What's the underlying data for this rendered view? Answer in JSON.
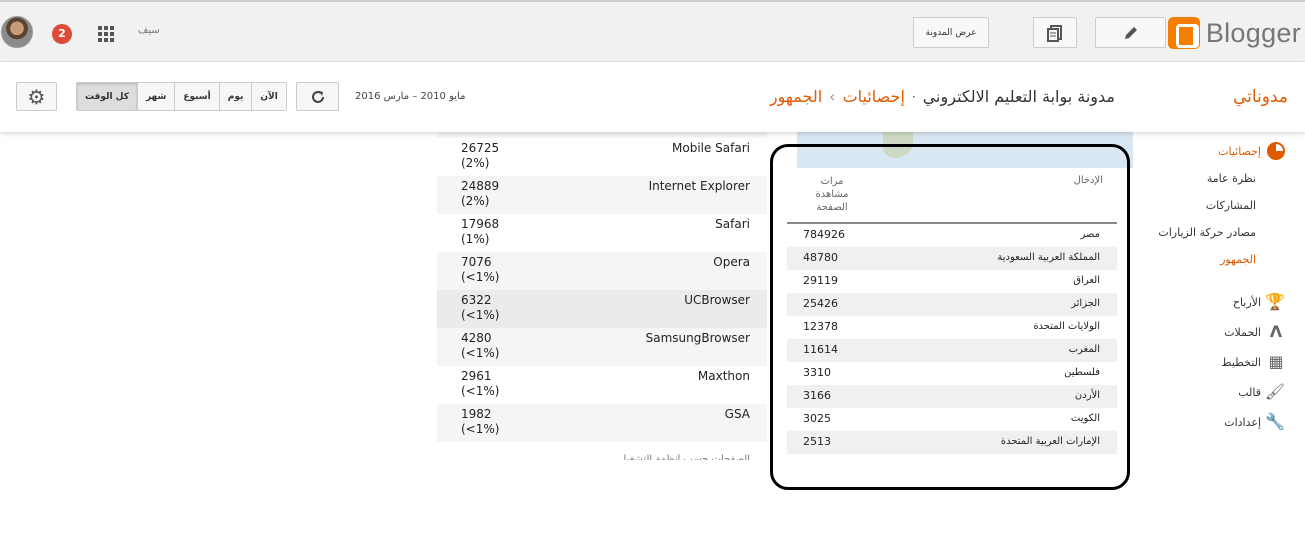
{
  "topbar": {
    "brand": "Blogger",
    "view_blog_label": "عرض المدونة",
    "username": "سيف",
    "notifications_count": "2"
  },
  "header": {
    "my_blogs": "مدوناتي",
    "blog_name": "مدونة بوابة التعليم الالكتروني",
    "crumb_stats": "إحصائيات",
    "crumb_audience": "الجمهور",
    "date_range": "مايو 2010 – مارس 2016",
    "periods": [
      "كل الوقت",
      "شهر",
      "أسبوع",
      "يوم",
      "الآن"
    ]
  },
  "sidebar": {
    "stats": "إحصائيات",
    "overview": "نظرة عامة",
    "posts": "المشاركات",
    "traffic_sources": "مصادر حركة الزيارات",
    "audience": "الجمهور",
    "earnings": "الأرباح",
    "campaigns": "الحملات",
    "layout": "التخطيط",
    "template": "قالب",
    "settings": "إعدادات"
  },
  "countries": {
    "col_entry": "الإدخال",
    "col_views": "مرات مشاهدة الصفحة",
    "rows": [
      {
        "name": "مصر",
        "value": "784926"
      },
      {
        "name": "المملكة العربية السعودية",
        "value": "48780"
      },
      {
        "name": "العراق",
        "value": "29119"
      },
      {
        "name": "الجزائر",
        "value": "25426"
      },
      {
        "name": "الولايات المتحدة",
        "value": "12378"
      },
      {
        "name": "المغرب",
        "value": "11614"
      },
      {
        "name": "فلسطين",
        "value": "3310"
      },
      {
        "name": "الأردن",
        "value": "3166"
      },
      {
        "name": "الكويت",
        "value": "3025"
      },
      {
        "name": "الإمارات العربية المتحدة",
        "value": "2513"
      }
    ]
  },
  "browsers": {
    "rows": [
      {
        "name": "Mobile Safari",
        "value": "26725",
        "pct": "(2%)"
      },
      {
        "name": "Internet Explorer",
        "value": "24889",
        "pct": "(2%)"
      },
      {
        "name": "Safari",
        "value": "17968",
        "pct": "(1%)"
      },
      {
        "name": "Opera",
        "value": "7076",
        "pct": "(<1%)"
      },
      {
        "name": "UCBrowser",
        "value": "6322",
        "pct": "(<1%)"
      },
      {
        "name": "SamsungBrowser",
        "value": "4280",
        "pct": "(<1%)"
      },
      {
        "name": "Maxthon",
        "value": "2961",
        "pct": "(<1%)"
      },
      {
        "name": "GSA",
        "value": "1982",
        "pct": "(<1%)"
      }
    ],
    "cutoff_text": "الصفحات حسب أنظمة التشغيل"
  },
  "colors": {
    "accent": "#e05a00",
    "brand": "#f57d00",
    "badge": "#dd4b39"
  },
  "icons": [
    "gear-icon",
    "refresh-icon",
    "pencil-icon",
    "posts-icon",
    "apps-grid-icon",
    "trophy-icon",
    "campaigns-icon",
    "layout-icon",
    "paint-roller-icon",
    "wrench-icon",
    "pie-chart-icon"
  ]
}
